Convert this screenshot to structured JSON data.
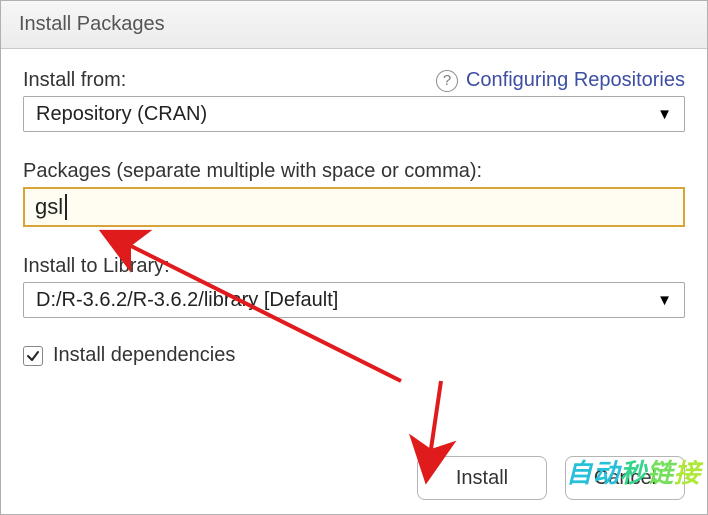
{
  "dialog": {
    "title": "Install Packages"
  },
  "install_from": {
    "label": "Install from:",
    "help_link_text": "Configuring Repositories",
    "selected": "Repository (CRAN)"
  },
  "packages": {
    "label": "Packages (separate multiple with space or comma):",
    "value": "gsl"
  },
  "install_to": {
    "label": "Install to Library:",
    "selected": "D:/R-3.6.2/R-3.6.2/library [Default]"
  },
  "dependencies": {
    "label": "Install dependencies",
    "checked": true
  },
  "buttons": {
    "install": "Install",
    "cancel": "Cancel"
  },
  "watermark": "自动秒链接",
  "colors": {
    "highlight_border": "#d6a437",
    "link": "#3d4ea3",
    "arrow": "#e01b1b"
  }
}
